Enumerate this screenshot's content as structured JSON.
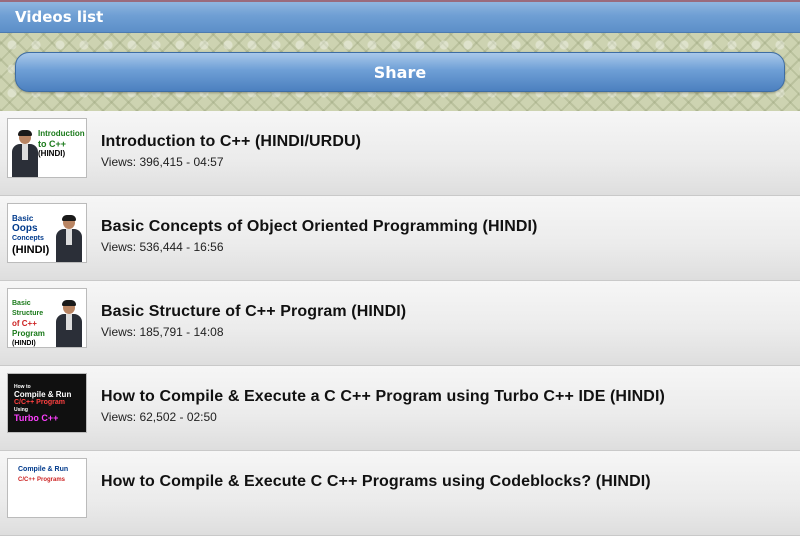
{
  "app": {
    "title": "Videos list"
  },
  "toolbar": {
    "share_label": "Share"
  },
  "videos": [
    {
      "title": "Introduction to C++ (HINDI/URDU)",
      "meta": "Views: 396,415 - 04:57",
      "thumb_text": [
        "Introduction",
        "to C++",
        "(HINDI)"
      ],
      "thumb_colors": [
        "#1a7a1a",
        "#1a7a1a",
        "#000000"
      ]
    },
    {
      "title": "Basic Concepts of Object Oriented Programming (HINDI)",
      "meta": "Views: 536,444 - 16:56",
      "thumb_text": [
        "Basic",
        "Oops",
        "Concepts",
        "(HINDI)"
      ],
      "thumb_colors": [
        "#003a8c",
        "#003a8c",
        "#003a8c",
        "#000000"
      ]
    },
    {
      "title": "Basic Structure of C++ Program (HINDI)",
      "meta": "Views: 185,791 - 14:08",
      "thumb_text": [
        "Basic Structure",
        "of C++",
        "Program",
        "(HINDI)"
      ],
      "thumb_colors": [
        "#1a7a1a",
        "#cc2222",
        "#1a7a1a",
        "#000000"
      ]
    },
    {
      "title": "How to Compile & Execute a C C++ Program using Turbo C++ IDE (HINDI)",
      "meta": "Views: 62,502 - 02:50",
      "thumb_text": [
        "How to",
        "Compile & Run",
        "C/C++ Program",
        "Using",
        "Turbo C++"
      ],
      "thumb_colors": [
        "#ffffff",
        "#ffffff",
        "#ff4040",
        "#ffffff",
        "#ff40ff"
      ]
    },
    {
      "title": "How to Compile & Execute C C++ Programs using Codeblocks? (HINDI)",
      "meta": "",
      "thumb_text": [
        "Compile & Run",
        "C/C++ Programs"
      ],
      "thumb_colors": [
        "#003a8c",
        "#cc2222"
      ]
    }
  ]
}
